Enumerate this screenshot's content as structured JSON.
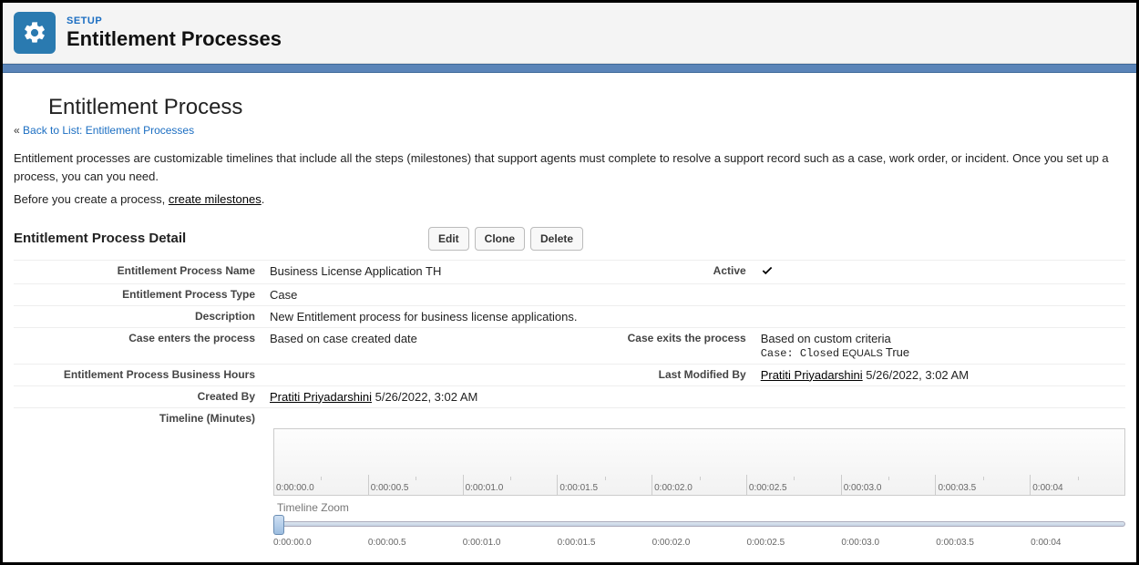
{
  "header": {
    "setup_label": "SETUP",
    "setup_title": "Entitlement Processes"
  },
  "page": {
    "title": "Entitlement Process",
    "back_prefix": "« ",
    "back_link": "Back to List: Entitlement Processes",
    "intro": "Entitlement processes are customizable timelines that include all the steps (milestones) that support agents must complete to resolve a support record such as a case, work order, or incident. Once you set up a process, you can you need.",
    "before_text": "Before you create a process, ",
    "create_milestones": "create milestones",
    "period": "."
  },
  "section": {
    "header": "Entitlement Process Detail",
    "buttons": {
      "edit": "Edit",
      "clone": "Clone",
      "delete": "Delete"
    }
  },
  "detail": {
    "name_label": "Entitlement Process Name",
    "name_value": "Business License Application TH",
    "active_label": "Active",
    "type_label": "Entitlement Process Type",
    "type_value": "Case",
    "description_label": "Description",
    "description_value": "New Entitlement process for business license applications.",
    "enters_label": "Case enters the process",
    "enters_value": "Based on case created date",
    "exits_label": "Case exits the process",
    "exits_value_line1": "Based on custom criteria",
    "exits_value_line2_a": "Case: Closed",
    "exits_value_line2_b": " EQUALS ",
    "exits_value_line2_c": "True",
    "bh_label": "Entitlement Process Business Hours",
    "lastmod_label": "Last Modified By",
    "lastmod_user": "Pratiti Priyadarshini",
    "lastmod_ts": " 5/26/2022, 3:02 AM",
    "createdby_label": "Created By",
    "createdby_user": "Pratiti Priyadarshini",
    "createdby_ts": " 5/26/2022, 3:02 AM",
    "timeline_label": "Timeline (Minutes)"
  },
  "timeline": {
    "ticks": [
      "0:00:00.0",
      "0:00:00.5",
      "0:00:01.0",
      "0:00:01.5",
      "0:00:02.0",
      "0:00:02.5",
      "0:00:03.0",
      "0:00:03.5",
      "0:00:04"
    ],
    "zoom_label": "Timeline Zoom",
    "zoom_ticks": [
      "0:00:00.0",
      "0:00:00.5",
      "0:00:01.0",
      "0:00:01.5",
      "0:00:02.0",
      "0:00:02.5",
      "0:00:03.0",
      "0:00:03.5",
      "0:00:04"
    ]
  }
}
